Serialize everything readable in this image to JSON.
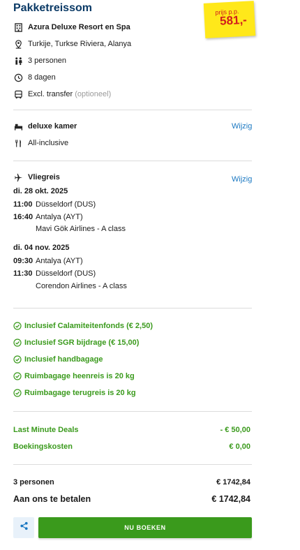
{
  "title": "Pakketreissom",
  "price": {
    "label": "prijs p.p.",
    "amount": "581,-",
    "bg_color": "#ffe81a",
    "text_color": "#d11d1d"
  },
  "trip": {
    "hotel": "Azura Deluxe Resort en Spa",
    "location": "Turkije, Turkse Riviera, Alanya",
    "persons": "3 personen",
    "duration": "8 dagen",
    "transfer": "Excl. transfer",
    "transfer_note": "(optioneel)"
  },
  "room": {
    "type": "deluxe kamer",
    "board": "All-inclusive",
    "change_label": "Wijzig"
  },
  "flight": {
    "title": "Vliegreis",
    "change_label": "Wijzig",
    "outbound": {
      "date": "di. 28 okt. 2025",
      "dep_time": "11:00",
      "dep_airport": "Düsseldorf (DUS)",
      "arr_time": "16:40",
      "arr_airport": "Antalya (AYT)",
      "airline": "Mavi Gök Airlines - A class"
    },
    "return": {
      "date": "di. 04 nov. 2025",
      "dep_time": "09:30",
      "dep_airport": "Antalya (AYT)",
      "arr_time": "11:30",
      "arr_airport": "Düsseldorf (DUS)",
      "airline": "Corendon Airlines - A class"
    }
  },
  "inclusions": [
    "Inclusief Calamiteitenfonds (€ 2,50)",
    "Inclusief SGR bijdrage (€ 15,00)",
    "Inclusief handbagage",
    "Ruimbagage heenreis is 20 kg",
    "Ruimbagage terugreis is 20 kg"
  ],
  "costs": [
    {
      "label": "Last Minute Deals",
      "value": "- € 50,00"
    },
    {
      "label": "Boekingskosten",
      "value": "€ 0,00"
    }
  ],
  "totals": {
    "persons_label": "3 personen",
    "persons_value": "€ 1742,84",
    "pay_label": "Aan ons te betalen",
    "pay_value": "€ 1742,84"
  },
  "actions": {
    "book_label": "NU BOEKEN",
    "share_icon": "share-icon"
  },
  "colors": {
    "title": "#0b3a66",
    "link": "#1a78c2",
    "green": "#3a9a1c"
  }
}
